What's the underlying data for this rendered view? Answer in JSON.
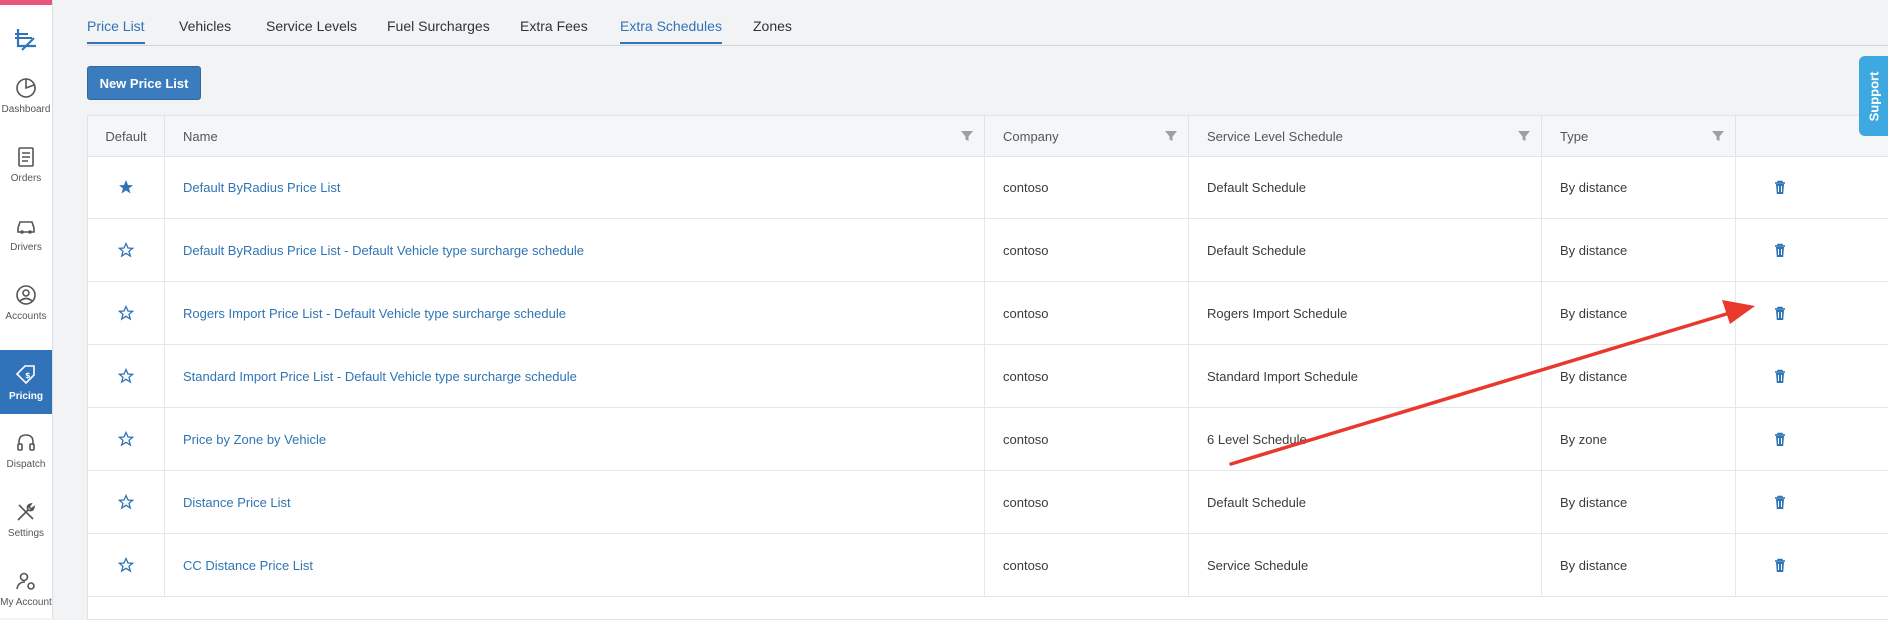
{
  "sidebar": {
    "items": [
      {
        "label": "Dashboard",
        "icon": "dashboard-icon"
      },
      {
        "label": "Orders",
        "icon": "orders-icon"
      },
      {
        "label": "Drivers",
        "icon": "car-icon"
      },
      {
        "label": "Accounts",
        "icon": "user-circle-icon"
      },
      {
        "label": "Pricing",
        "icon": "price-tag-icon",
        "active": true
      },
      {
        "label": "Dispatch",
        "icon": "headset-icon"
      },
      {
        "label": "Settings",
        "icon": "tools-icon"
      },
      {
        "label": "My Account",
        "icon": "user-gear-icon"
      }
    ]
  },
  "tabs": [
    {
      "label": "Price List"
    },
    {
      "label": "Vehicles"
    },
    {
      "label": "Service Levels"
    },
    {
      "label": "Fuel Surcharges"
    },
    {
      "label": "Extra Fees"
    },
    {
      "label": "Extra Schedules"
    },
    {
      "label": "Zones"
    }
  ],
  "actions": {
    "new_price_list": "New Price List"
  },
  "table": {
    "headers": {
      "default": "Default",
      "name": "Name",
      "company": "Company",
      "service_level_schedule": "Service Level Schedule",
      "type": "Type"
    },
    "rows": [
      {
        "default": true,
        "name": "Default ByRadius Price List",
        "company": "contoso",
        "schedule": "Default Schedule",
        "type": "By distance"
      },
      {
        "default": false,
        "name": "Default ByRadius Price List - Default Vehicle type surcharge schedule",
        "company": "contoso",
        "schedule": "Default Schedule",
        "type": "By distance"
      },
      {
        "default": false,
        "name": "Rogers Import Price List - Default Vehicle type surcharge schedule",
        "company": "contoso",
        "schedule": "Rogers Import Schedule",
        "type": "By distance"
      },
      {
        "default": false,
        "name": "Standard Import Price List - Default Vehicle type surcharge schedule",
        "company": "contoso",
        "schedule": "Standard Import Schedule",
        "type": "By distance"
      },
      {
        "default": false,
        "name": "Price by Zone by Vehicle",
        "company": "contoso",
        "schedule": "6 Level Schedule",
        "type": "By zone"
      },
      {
        "default": false,
        "name": "Distance Price List",
        "company": "contoso",
        "schedule": "Default Schedule",
        "type": "By distance"
      },
      {
        "default": false,
        "name": "CC Distance Price List",
        "company": "contoso",
        "schedule": "Service Schedule",
        "type": "By distance"
      }
    ]
  },
  "support": {
    "label": "Support"
  },
  "colors": {
    "accent": "#3173b9",
    "brand_bar": "#e8557b",
    "support": "#3ea8e0",
    "annotation_arrow": "#e8392c"
  }
}
